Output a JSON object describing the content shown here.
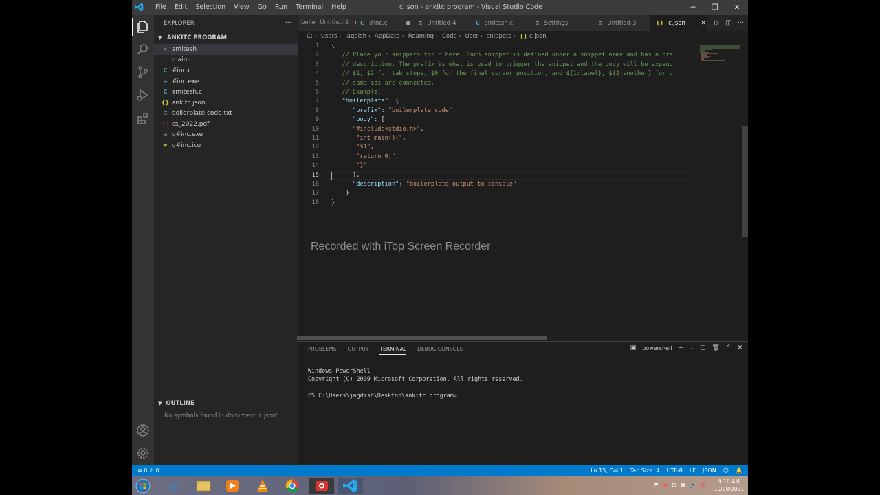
{
  "titlebar": {
    "menu": [
      "File",
      "Edit",
      "Selection",
      "View",
      "Go",
      "Run",
      "Terminal",
      "Help"
    ],
    "title": "c.json - ankitc program - Visual Studio Code"
  },
  "sidebar": {
    "header": "EXPLORER",
    "folder": "ANKITC PROGRAM",
    "files": [
      {
        "name": "amitesh",
        "icon": "›"
      },
      {
        "name": "main.c",
        "icon": ""
      },
      {
        "name": "#inc.c",
        "icon": "C"
      },
      {
        "name": "#inc.exe",
        "icon": "≡"
      },
      {
        "name": "amitesh.c",
        "icon": "C"
      },
      {
        "name": "ankitc.json",
        "icon": "{}"
      },
      {
        "name": "boilerplate code.txt",
        "icon": "≡"
      },
      {
        "name": "cs_2022.pdf",
        "icon": "⬚"
      },
      {
        "name": "g#inc.exe",
        "icon": "≡"
      },
      {
        "name": "g#inc.ico",
        "icon": "★"
      }
    ],
    "outline_title": "OUTLINE",
    "outline_message": "No symbols found in document 'c.json'"
  },
  "tabs": [
    {
      "label": "boile",
      "sub": "Untitled-2",
      "icon": ""
    },
    {
      "label": "#inc.c",
      "icon": "C"
    },
    {
      "label": "Untitled-4",
      "icon": "≡"
    },
    {
      "label": "amitesh.c",
      "icon": "C"
    },
    {
      "label": "Settings",
      "icon": "≡"
    },
    {
      "label": "Untitled-3",
      "icon": "≡"
    },
    {
      "label": "c.json",
      "icon": "{}"
    }
  ],
  "breadcrumb": [
    "C:",
    "Users",
    "jagdish",
    "AppData",
    "Roaming",
    "Code",
    "User",
    "snippets",
    "c.json"
  ],
  "code": {
    "lines": [
      "{",
      "\t// Place your snippets for c here. Each snippet is defined under a snippet name and has a pre",
      "\t// description. The prefix is what is used to trigger the snippet and the body will be expand",
      "\t// $1, $2 for tab stops, $0 for the final cursor position, and ${1:label}, ${2:another} for p",
      "\t// same ids are connected.",
      "\t// Example:",
      "\t\"boilerplate\": {",
      "\t\t\"prefix\": \"boilerplate code\",",
      "\t\t\"body\": [",
      "\t\t\"#include<stdio.h>\",",
      "\t\t \"int main(){\",",
      "\t\t \"$1\",",
      "\t\t \"return 0;\",",
      "\t\t \"}\"",
      "\t\t],",
      "\t\t\"description\": \"boilerplate output to console\"",
      "\t }",
      "}"
    ],
    "current_line": 15
  },
  "watermark": "Recorded with iTop Screen Recorder",
  "panel": {
    "tabs": [
      "PROBLEMS",
      "OUTPUT",
      "TERMINAL",
      "DEBUG CONSOLE"
    ],
    "active_tab": "TERMINAL",
    "shell": "powershell",
    "terminal_lines": [
      "Windows PowerShell",
      "Copyright (C) 2009 Microsoft Corporation. All rights reserved.",
      "",
      "PS C:\\Users\\jagdish\\Desktop\\ankitc program>"
    ]
  },
  "status": {
    "errors": "0",
    "warnings": "0",
    "position": "Ln 15, Col 1",
    "tab_size": "Tab Size: 4",
    "encoding": "UTF-8",
    "eol": "LF",
    "language": "JSON"
  },
  "taskbar": {
    "time": "9:10 AM",
    "date": "10/28/2021"
  },
  "colors": {
    "statusbar": "#007acc",
    "editor_bg": "#1e1e1e",
    "sidebar_bg": "#252526",
    "comment": "#6a9955",
    "string": "#ce9178",
    "key": "#9cdcfe"
  }
}
